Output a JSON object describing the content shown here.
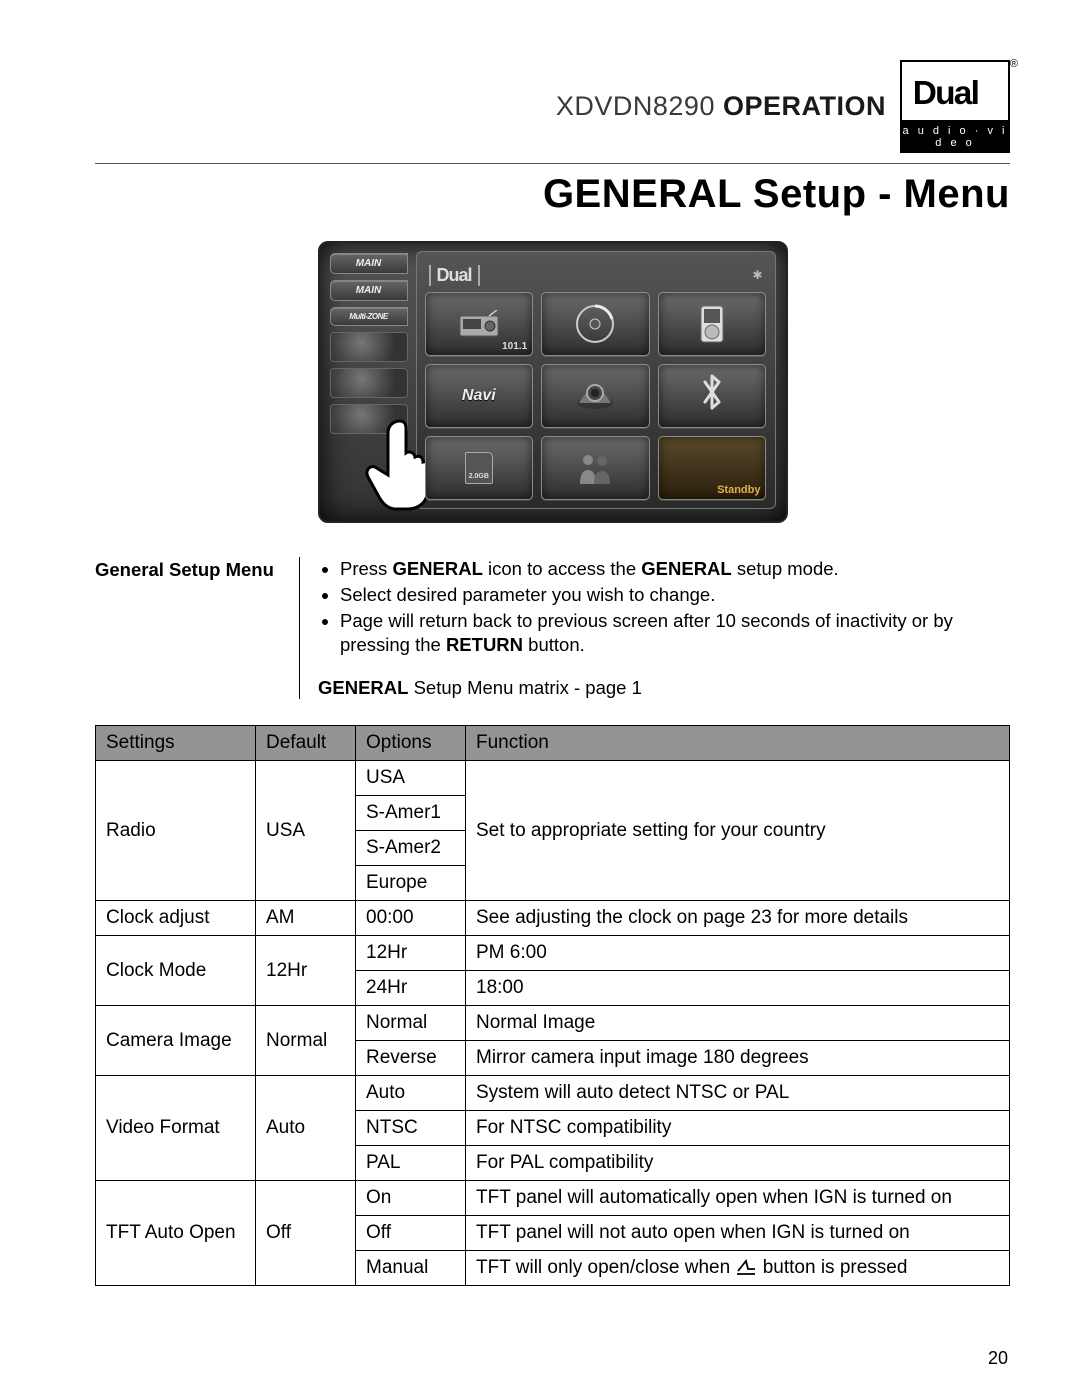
{
  "header": {
    "model": "XDVDN8290",
    "operation": "OPERATION",
    "logo_text": "Dual",
    "logo_tag": "a u d i o · v i d e o"
  },
  "page_title": "GENERAL Setup - Menu",
  "device": {
    "tabs": [
      "MAIN",
      "MAIN",
      "Multi-ZONE"
    ],
    "brand": "Dual",
    "bt_icon": "✱",
    "grid": {
      "radio_freq": "101.1",
      "navi": "Navi",
      "sd": "2.0GB",
      "standby": "Standby"
    }
  },
  "instructions": {
    "label": "General Setup Menu",
    "bullets": [
      {
        "pre": "Press ",
        "b1": "GENERAL",
        "mid": " icon to access the ",
        "b2": "GENERAL",
        "post": " setup mode."
      },
      {
        "text": "Select desired parameter you wish to change."
      },
      {
        "pre": "Page will return back to previous screen after 10 seconds of inactivity or by pressing the ",
        "b1": "RETURN",
        "post": " button."
      }
    ],
    "matrix_line_b": "GENERAL",
    "matrix_line_rest": " Setup Menu matrix - page 1"
  },
  "table": {
    "headers": {
      "settings": "Settings",
      "default": "Default",
      "options": "Options",
      "function": "Function"
    },
    "rows": {
      "radio": {
        "setting": "Radio",
        "default": "USA",
        "options": [
          "USA",
          "S-Amer1",
          "S-Amer2",
          "Europe"
        ],
        "function": "Set to appropriate setting for your country"
      },
      "clock_adjust": {
        "setting": "Clock adjust",
        "default": "AM",
        "option": "00:00",
        "function": "See adjusting the clock on page 23 for more details"
      },
      "clock_mode": {
        "setting": "Clock Mode",
        "default": "12Hr",
        "options": [
          "12Hr",
          "24Hr"
        ],
        "functions": [
          "PM 6:00",
          "18:00"
        ]
      },
      "camera": {
        "setting": "Camera Image",
        "default": "Normal",
        "options": [
          "Normal",
          "Reverse"
        ],
        "functions": [
          "Normal Image",
          "Mirror camera input image 180 degrees"
        ]
      },
      "video": {
        "setting": "Video Format",
        "default": "Auto",
        "options": [
          "Auto",
          "NTSC",
          "PAL"
        ],
        "functions": [
          "System will auto detect NTSC or PAL",
          "For NTSC compatibility",
          "For PAL compatibility"
        ]
      },
      "tft": {
        "setting": "TFT Auto Open",
        "default": "Off",
        "options": [
          "On",
          "Off",
          "Manual"
        ],
        "functions": [
          "TFT panel will automatically open when IGN is turned on",
          "TFT panel will not auto open when IGN is turned on",
          "TFT will only open/close when ",
          " button is pressed"
        ]
      }
    }
  },
  "page_number": "20"
}
